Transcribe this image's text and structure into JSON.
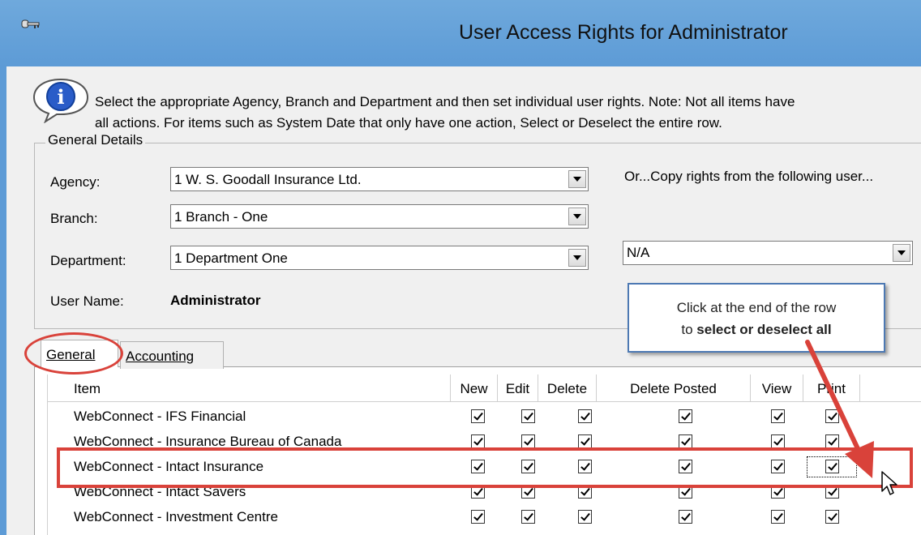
{
  "window": {
    "title": "User Access Rights for Administrator"
  },
  "info": {
    "line1": "Select the appropriate Agency, Branch and Department and then set individual user rights.  Note:  Not all items have",
    "line2": "all actions.  For items such as System Date that only have one action, Select or Deselect the entire row."
  },
  "general_details": {
    "legend": "General Details",
    "agency_label": "Agency:",
    "agency_value": "1 W. S. Goodall Insurance Ltd.",
    "branch_label": "Branch:",
    "branch_value": "1 Branch - One",
    "department_label": "Department:",
    "department_value": "1 Department One",
    "username_label": "User Name:",
    "username_value": "Administrator",
    "copy_label": "Or...Copy rights from the following user...",
    "copy_value": "N/A"
  },
  "tabs": [
    {
      "label": "General",
      "active": true
    },
    {
      "label": "Accounting",
      "active": false
    }
  ],
  "grid": {
    "columns": [
      "Item",
      "New",
      "Edit",
      "Delete",
      "Delete Posted",
      "View",
      "Print"
    ],
    "rows": [
      {
        "item": "WebConnect - IFS Financial",
        "checks": [
          true,
          true,
          true,
          true,
          true,
          true
        ]
      },
      {
        "item": "WebConnect - Insurance Bureau of Canada",
        "checks": [
          true,
          true,
          true,
          true,
          true,
          true
        ]
      },
      {
        "item": "WebConnect - Intact Insurance",
        "checks": [
          true,
          true,
          true,
          true,
          true,
          true
        ]
      },
      {
        "item": "WebConnect - Intact Savers",
        "checks": [
          true,
          true,
          true,
          true,
          true,
          true
        ]
      },
      {
        "item": "WebConnect - Investment Centre",
        "checks": [
          true,
          true,
          true,
          true,
          true,
          true
        ]
      }
    ]
  },
  "callout": {
    "line1": "Click at the end of the row",
    "line2_prefix": "to ",
    "line2_bold": "select or deselect all"
  },
  "colors": {
    "annotation_red": "#d9423a",
    "titlebar": "#5d9bd6",
    "callout_border": "#4d79b3"
  }
}
